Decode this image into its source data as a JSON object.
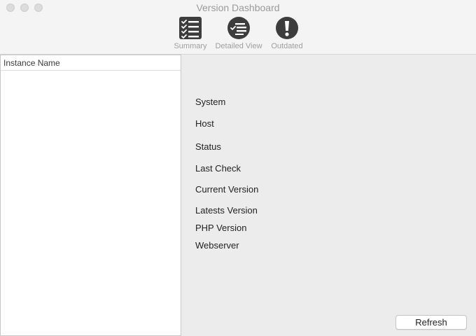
{
  "window": {
    "title": "Version Dashboard"
  },
  "toolbar": {
    "items": [
      {
        "label": "Summary",
        "icon": "checklist-icon"
      },
      {
        "label": "Detailed View",
        "icon": "detailed-list-icon"
      },
      {
        "label": "Outdated",
        "icon": "exclamation-icon"
      }
    ]
  },
  "list": {
    "column_header": "Instance Name",
    "rows": []
  },
  "details": {
    "labels": {
      "system": "System",
      "host": "Host",
      "status": "Status",
      "last_check": "Last Check",
      "current_version": "Current Version",
      "latest_version": "Latests Version",
      "php_version": "PHP Version",
      "webserver": "Webserver"
    }
  },
  "actions": {
    "refresh_label": "Refresh"
  },
  "colors": {
    "icon": "#3d3d3d",
    "toolbar_label": "#9e9e9e",
    "background": "#ececec"
  }
}
